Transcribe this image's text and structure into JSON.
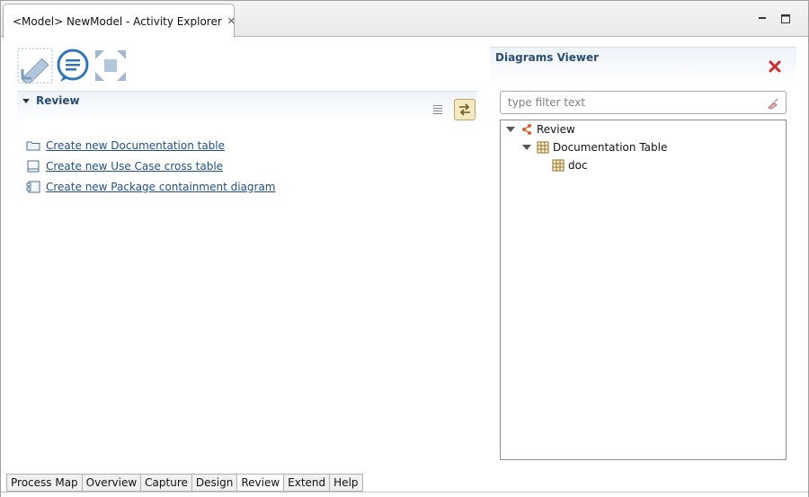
{
  "window": {
    "tab_title": "<Model> NewModel - Activity Explorer",
    "tab_icon": "activity-explorer-icon",
    "close_icon": "close-icon",
    "minimize_icon": "minimize-icon",
    "maximize_icon": "maximize-icon"
  },
  "toolbar": {
    "icons": [
      "design-ruler-icon",
      "comment-bubble-icon",
      "expand-arrows-icon"
    ]
  },
  "review_section": {
    "title": "Review",
    "tools": [
      "list-icon",
      "sync-link-icon"
    ],
    "links": [
      {
        "label": "Create new Documentation table",
        "icon": "folder-icon"
      },
      {
        "label": "Create new Use Case cross table",
        "icon": "table-icon"
      },
      {
        "label": "Create new Package containment diagram",
        "icon": "package-diagram-icon"
      }
    ]
  },
  "diagrams_viewer": {
    "title": "Diagrams Viewer",
    "close_icon": "red-x-icon",
    "filter_placeholder": "type filter text",
    "filter_value": "",
    "tree": [
      {
        "label": "Review",
        "icon": "review-icon",
        "expanded": true
      },
      {
        "label": "Documentation Table",
        "icon": "table-icon",
        "expanded": true
      },
      {
        "label": "doc",
        "icon": "table-icon",
        "expanded": false
      }
    ]
  },
  "bottom_tabs": {
    "items": [
      "Process Map",
      "Overview",
      "Capture",
      "Design",
      "Review",
      "Extend",
      "Help"
    ],
    "active": "Review"
  },
  "colors": {
    "accent_text": "#2b4d73",
    "link": "#1f4f8a",
    "close_red": "#d22a2a",
    "active_tool_bg": "#f4e9c1"
  }
}
